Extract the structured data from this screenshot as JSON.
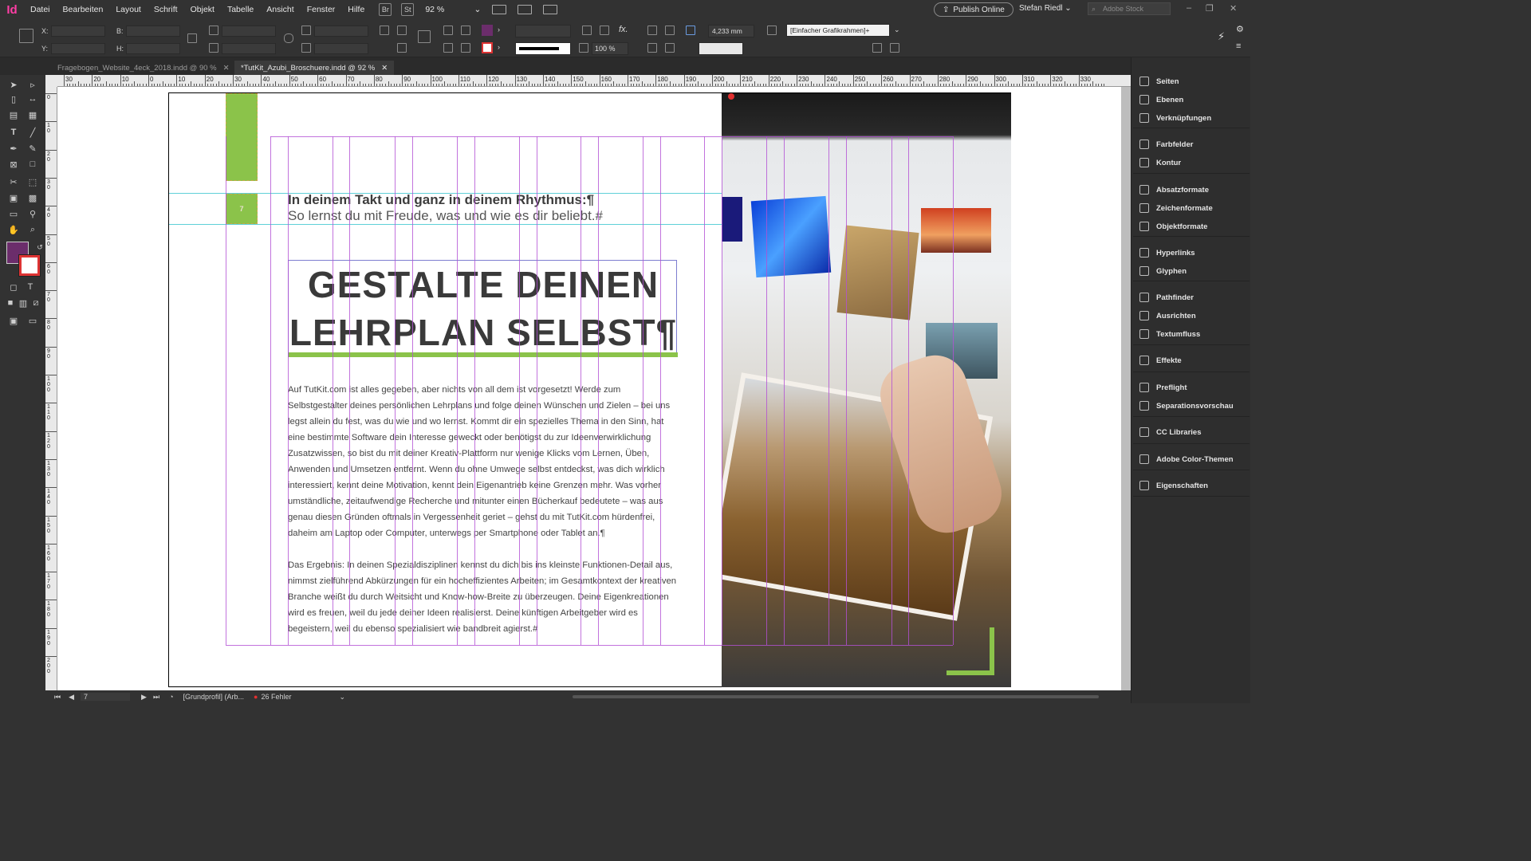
{
  "app": {
    "logo": "Id"
  },
  "menu": [
    "Datei",
    "Bearbeiten",
    "Layout",
    "Schrift",
    "Objekt",
    "Tabelle",
    "Ansicht",
    "Fenster",
    "Hilfe"
  ],
  "menubar": {
    "badge_br": "Br",
    "badge_st": "St",
    "zoom": "92 %",
    "publish_label": "Publish Online",
    "user": "Stefan Riedl",
    "search_placeholder": "Adobe Stock"
  },
  "controlbar": {
    "x_label": "X:",
    "y_label": "Y:",
    "w_label": "B:",
    "h_label": "H:",
    "stroke_weight": "4,233 mm",
    "opacity": "100 %",
    "object_style": "[Einfacher Grafikrahmen]+",
    "fill_color": "#6b2d6b"
  },
  "tabs": [
    {
      "label": "Fragebogen_Website_4eck_2018.indd @ 90 %",
      "active": false
    },
    {
      "label": "*TutKit_Azubi_Broschuere.indd @ 92 %",
      "active": true
    }
  ],
  "ruler_h_labels": [
    "30",
    "20",
    "10",
    "0",
    "10",
    "20",
    "30",
    "40",
    "50",
    "60",
    "70",
    "80",
    "90",
    "100",
    "110",
    "120",
    "130",
    "140",
    "150",
    "160",
    "170",
    "180",
    "190",
    "200",
    "210",
    "220",
    "230",
    "240",
    "250",
    "260",
    "270",
    "280",
    "290",
    "300",
    "310",
    "320",
    "330"
  ],
  "ruler_v_labels": [
    "0",
    "1 0",
    "2 0",
    "3 0",
    "4 0",
    "5 0",
    "6 0",
    "7 0",
    "8 0",
    "9 0",
    "1 0 0",
    "1 1 0",
    "1 2 0",
    "1 3 0",
    "1 4 0",
    "1 5 0",
    "1 6 0",
    "1 7 0",
    "1 8 0",
    "1 9 0",
    "2 0 0"
  ],
  "document": {
    "subheadline_1": "In deinem Takt und ganz in deinem Rhythmus:¶",
    "subheadline_2": "So lernst du mit Freude, was und wie es dir beliebt.#",
    "title_line_1": "GESTALTE DEINEN",
    "title_line_2": "LEHRPLAN SELBST¶",
    "paragraph_1": "Auf TutKit.com ist alles gegeben, aber nichts von all dem ist vorgesetzt! Werde zum Selbstgestalter deines persönlichen Lehrplans und folge deinen Wünschen und Zielen – bei uns legst allein du fest, was du wie und wo lernst. Kommt dir ein spezielles Thema in den Sinn, hat eine bestimmte Software dein Interesse geweckt oder benötigst du zur Ideenverwirklichung Zusatzwissen, so bist du mit deiner Kreativ-Plattform nur wenige Klicks vom Lernen, Üben, Anwenden und Umsetzen entfernt. Wenn du ohne Umwege selbst entdeckst, was dich wirklich interessiert, kennt deine Motivation, kennt dein Eigenantrieb keine Grenzen mehr. Was vorher umständliche, zeitaufwendige Recherche und mitunter einen Bücherkauf bedeutete – was aus genau diesen Gründen oftmals in Vergessenheit geriet – gehst du mit TutKit.com hürdenfrei, daheim am Laptop oder Computer, unterwegs per Smartphone oder Tablet an.¶",
    "paragraph_2": "Das Ergebnis: In deinen Spezialdisziplinen kennst du dich bis ins kleinste Funktionen-Detail aus, nimmst zielführend Abkürzungen für ein hocheffizientes Arbeiten; im Gesamtkontext der kreativen Branche weißt du durch Weitsicht und Know-how-Breite zu überzeugen. Deine Eigenkreationen wird es freuen, weil du jede deiner Ideen realisierst. Deine künftigen Arbeitgeber wird es begeistern, weil du ebenso spezialisiert wie bandbreit agierst.#",
    "page_number_marker": "7",
    "accent_green": "#8bc34a"
  },
  "statusbar": {
    "page": "7",
    "profile": "[Grundprofil] (Arb...",
    "errors": "26 Fehler"
  },
  "panels": [
    {
      "label": "Seiten",
      "icon": "pages-icon"
    },
    {
      "label": "Ebenen",
      "icon": "layers-icon"
    },
    {
      "label": "Verknüpfungen",
      "icon": "links-icon"
    },
    {
      "label": "Farbfelder",
      "icon": "swatches-icon"
    },
    {
      "label": "Kontur",
      "icon": "stroke-icon"
    },
    {
      "label": "Absatzformate",
      "icon": "paragraph-styles-icon"
    },
    {
      "label": "Zeichenformate",
      "icon": "character-styles-icon"
    },
    {
      "label": "Objektformate",
      "icon": "object-styles-icon"
    },
    {
      "label": "Hyperlinks",
      "icon": "hyperlinks-icon"
    },
    {
      "label": "Glyphen",
      "icon": "glyphs-icon"
    },
    {
      "label": "Pathfinder",
      "icon": "pathfinder-icon"
    },
    {
      "label": "Ausrichten",
      "icon": "align-icon"
    },
    {
      "label": "Textumfluss",
      "icon": "text-wrap-icon"
    },
    {
      "label": "Effekte",
      "icon": "effects-icon"
    },
    {
      "label": "Preflight",
      "icon": "preflight-icon"
    },
    {
      "label": "Separationsvorschau",
      "icon": "separations-icon"
    },
    {
      "label": "CC Libraries",
      "icon": "cc-libraries-icon"
    },
    {
      "label": "Adobe Color-Themen",
      "icon": "color-themes-icon"
    },
    {
      "label": "Eigenschaften",
      "icon": "properties-icon"
    }
  ]
}
